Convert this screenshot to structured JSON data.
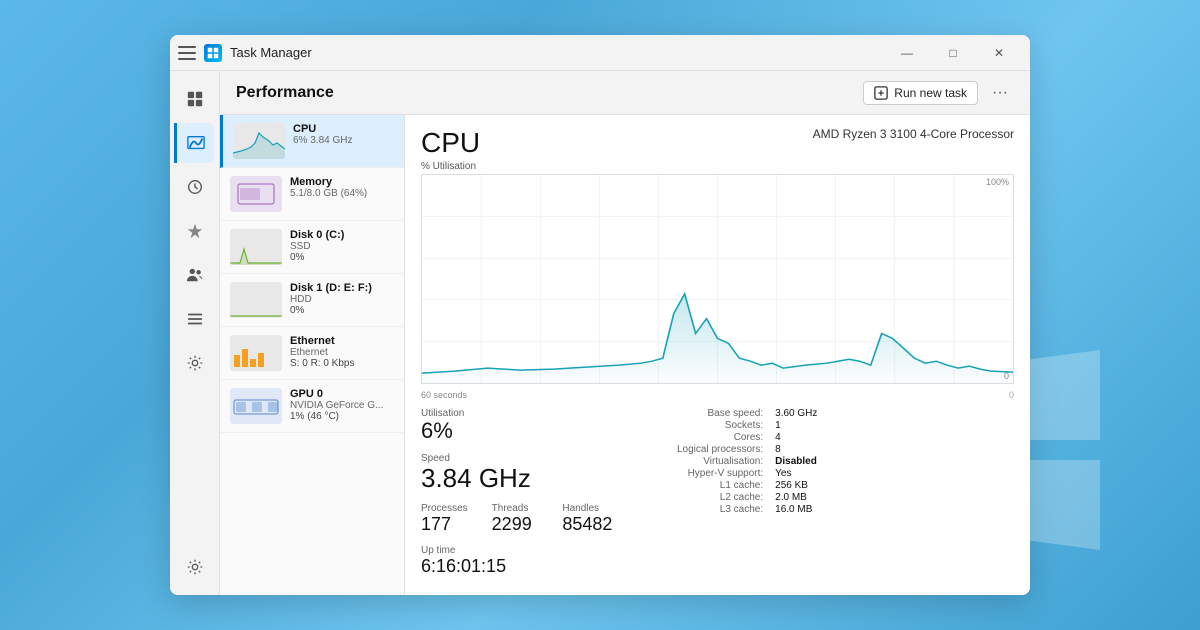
{
  "window": {
    "title": "Task Manager",
    "min_btn": "—",
    "max_btn": "□",
    "close_btn": "✕"
  },
  "header": {
    "title": "Performance",
    "run_task_label": "Run new task",
    "more_label": "···"
  },
  "devices": [
    {
      "name": "CPU",
      "sub": "6% 3.84 GHz",
      "type": "cpu",
      "active": true
    },
    {
      "name": "Memory",
      "sub": "5.1/8.0 GB (64%)",
      "type": "memory",
      "active": false
    },
    {
      "name": "Disk 0 (C:)",
      "sub": "SSD",
      "val": "0%",
      "type": "disk0",
      "active": false
    },
    {
      "name": "Disk 1 (D: E: F:)",
      "sub": "HDD",
      "val": "0%",
      "type": "disk1",
      "active": false
    },
    {
      "name": "Ethernet",
      "sub": "Ethernet",
      "val": "S: 0  R: 0 Kbps",
      "type": "ethernet",
      "active": false
    },
    {
      "name": "GPU 0",
      "sub": "NVIDIA GeForce G...",
      "val": "1% (46 °C)",
      "type": "gpu",
      "active": false
    }
  ],
  "cpu": {
    "label": "CPU",
    "model": "AMD Ryzen 3 3100 4-Core Processor",
    "chart_y_max": "100%",
    "chart_y_min": "0",
    "chart_x_start": "60 seconds",
    "chart_x_end": "0",
    "utilisation_label": "% Utilisation",
    "stats": {
      "utilisation_label": "Utilisation",
      "utilisation_value": "6%",
      "speed_label": "Speed",
      "speed_value": "3.84 GHz",
      "processes_label": "Processes",
      "processes_value": "177",
      "threads_label": "Threads",
      "threads_value": "2299",
      "handles_label": "Handles",
      "handles_value": "85482",
      "uptime_label": "Up time",
      "uptime_value": "6:16:01:15"
    },
    "info": {
      "base_speed_label": "Base speed:",
      "base_speed_value": "3.60 GHz",
      "sockets_label": "Sockets:",
      "sockets_value": "1",
      "cores_label": "Cores:",
      "cores_value": "4",
      "logical_label": "Logical processors:",
      "logical_value": "8",
      "virt_label": "Virtualisation:",
      "virt_value": "Disabled",
      "hyperv_label": "Hyper-V support:",
      "hyperv_value": "Yes",
      "l1_label": "L1 cache:",
      "l1_value": "256 KB",
      "l2_label": "L2 cache:",
      "l2_value": "2.0 MB",
      "l3_label": "L3 cache:",
      "l3_value": "16.0 MB"
    }
  },
  "sidebar": {
    "items": [
      {
        "id": "overview",
        "label": "Overview"
      },
      {
        "id": "performance",
        "label": "Performance"
      },
      {
        "id": "history",
        "label": "App history"
      },
      {
        "id": "startup",
        "label": "Startup"
      },
      {
        "id": "users",
        "label": "Users"
      },
      {
        "id": "details",
        "label": "Details"
      },
      {
        "id": "services",
        "label": "Services"
      }
    ],
    "settings_label": "Settings"
  },
  "colors": {
    "accent": "#0078d4",
    "chart_line": "#17a2b8",
    "chart_fill": "rgba(23,162,184,0.15)"
  }
}
